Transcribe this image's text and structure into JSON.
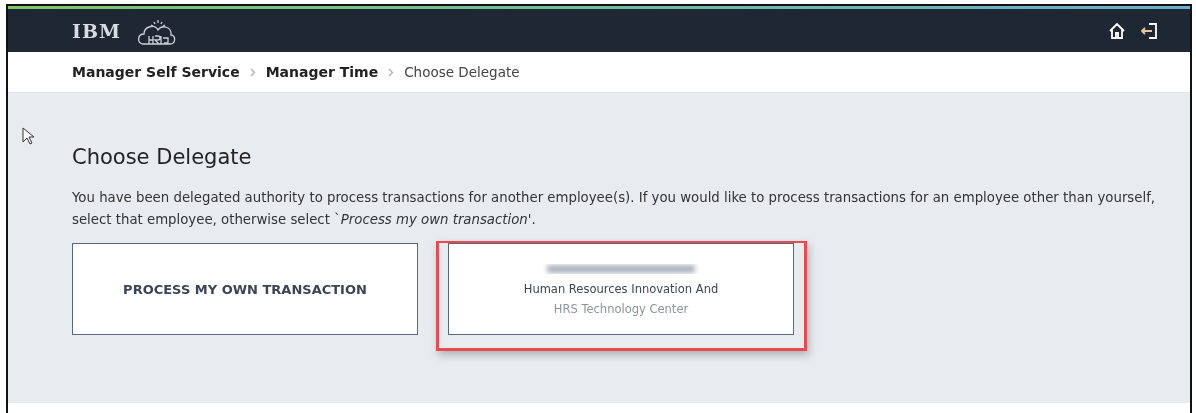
{
  "header": {
    "brand": "IBM"
  },
  "breadcrumb": [
    {
      "label": "Manager Self Service",
      "current": false
    },
    {
      "label": "Manager Time",
      "current": false
    },
    {
      "label": "Choose Delegate",
      "current": true
    }
  ],
  "page": {
    "title": "Choose Delegate",
    "description": "You have been delegated authority to process transactions for another employee(s). If you would like to process transactions for an employee other than yourself, select that employee, otherwise select  `*Process my own transaction'*."
  },
  "cards": [
    {
      "kind": "own",
      "label": "PROCESS MY OWN TRANSACTION",
      "highlighted": false
    },
    {
      "kind": "delegate",
      "department": "Human Resources Innovation And",
      "location": "HRS Technology Center",
      "highlighted": true
    }
  ]
}
